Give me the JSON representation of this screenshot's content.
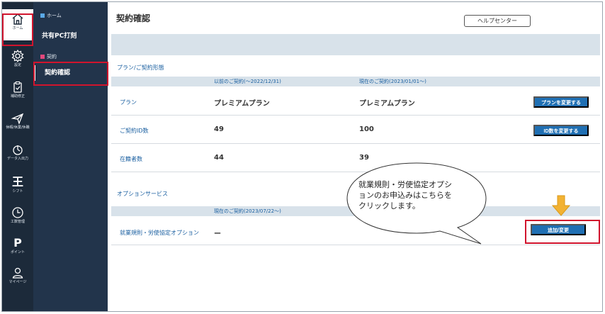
{
  "rail": [
    {
      "label": "ホーム",
      "icon": "home-icon",
      "active": true
    },
    {
      "label": "設定",
      "icon": "gear-icon"
    },
    {
      "label": "補助修正",
      "icon": "clipboard-icon"
    },
    {
      "label": "休暇/休業/休職",
      "icon": "send-icon"
    },
    {
      "label": "データ入出力",
      "icon": "power-icon"
    },
    {
      "label": "シフト",
      "icon": "shift-icon",
      "glyph": "王"
    },
    {
      "label": "工数管理",
      "icon": "clock-icon"
    },
    {
      "label": "ポイント",
      "icon": "point-icon",
      "glyph": "P"
    },
    {
      "label": "マイページ",
      "icon": "user-icon"
    }
  ],
  "subnav": {
    "home_section": "ホーム",
    "home_item": "共有PC打刻",
    "contract_section": "契約",
    "contract_item": "契約確認"
  },
  "colors": {
    "rail_bg": "#1c2a3a",
    "subnav_bg": "#22344b",
    "accent_blue": "#1f6fb3",
    "highlight_red": "#d1142d",
    "arrow_yellow": "#f2b233",
    "home_square": "#5aa9e6",
    "contract_square": "#e3487c"
  },
  "main": {
    "title": "契約確認",
    "help_button": "ヘルプセンター",
    "plan_section_title": "プラン/ご契約形態",
    "col_prev": "以前のご契約(～2022/12/31)",
    "col_curr": "現在のご契約(2023/01/01～)",
    "rows": [
      {
        "label": "プラン",
        "prev": "プレミアムプラン",
        "curr": "プレミアムプラン",
        "button": "プランを変更する"
      },
      {
        "label": "ご契約ID数",
        "prev": "49",
        "curr": "100",
        "button": "ID数を変更する"
      },
      {
        "label": "在籍者数",
        "prev": "44",
        "curr": "39"
      }
    ],
    "option_section_title": "オプションサービス",
    "option_col": "現在のご契約(2023/07/22～)",
    "option_row": {
      "label": "就業規則・労使協定オプション",
      "value": "ー",
      "button": "追加/変更"
    }
  },
  "callout": {
    "line1": "就業規則・労使協定オプシ",
    "line2": "ョンのお申込みはこちらを",
    "line3": "クリックします。"
  }
}
